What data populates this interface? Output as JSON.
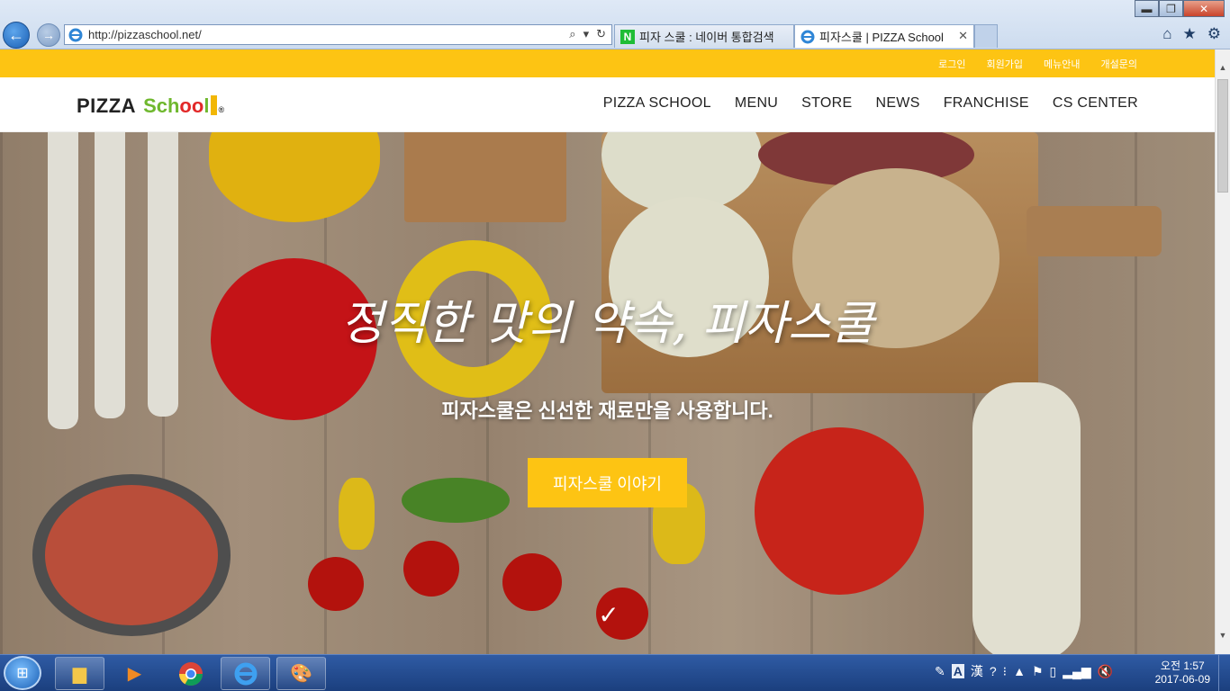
{
  "browser": {
    "address": "http://pizzaschool.net/",
    "tabs": [
      {
        "label": "피자 스쿨 : 네이버 통합검색",
        "favicon": "N"
      },
      {
        "label": "피자스쿨 | PIZZA School",
        "favicon": "ie"
      }
    ],
    "window_buttons": {
      "minimize": "▬",
      "maximize": "❐",
      "close": "✕"
    }
  },
  "site": {
    "utility_links": [
      "로그인",
      "회원가입",
      "메뉴안내",
      "개설문의"
    ],
    "logo": {
      "word1": "PIZZA",
      "word2a": "Sch",
      "word2b": "oo",
      "word2c": "l",
      "reg": "®"
    },
    "nav": [
      "PIZZA SCHOOL",
      "MENU",
      "STORE",
      "NEWS",
      "FRANCHISE",
      "CS CENTER"
    ],
    "hero": {
      "title": "정직한 맛의 약속, 피자스쿨",
      "subtitle": "피자스쿨은 신선한 재료만을 사용합니다.",
      "button": "피자스쿨 이야기",
      "scroll_icon": "✓"
    },
    "colors": {
      "accent": "#fdc413",
      "logo_green": "#6fb82e",
      "logo_red": "#e22828"
    }
  },
  "taskbar": {
    "apps": [
      "explorer",
      "media-player",
      "chrome",
      "internet-explorer",
      "paint"
    ],
    "clock_time": "오전 1:57",
    "clock_date": "2017-06-09",
    "tray_lang": "A",
    "tray_hanja": "漢"
  }
}
